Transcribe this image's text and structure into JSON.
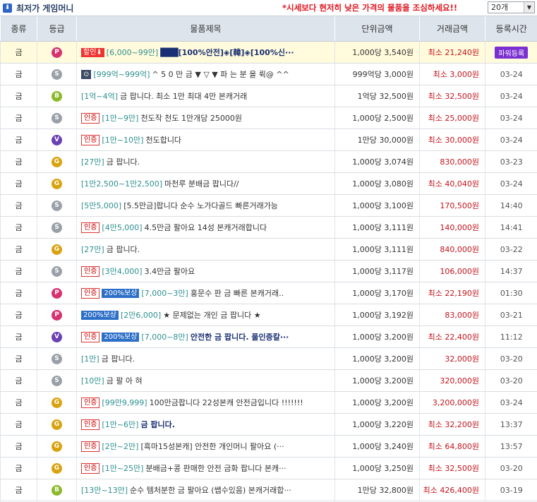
{
  "header": {
    "title": "최저가 게임머니",
    "notice": "*시세보다 현저히 낮은 가격의 물품을 조심하세요!!",
    "count_select": "20개"
  },
  "columns": [
    "종류",
    "등급",
    "물품제목",
    "단위금액",
    "거래금액",
    "등록시간"
  ],
  "rows": [
    {
      "kind": "금",
      "grade": "P",
      "badges": [
        {
          "t": "hot",
          "label": "할인⬇"
        }
      ],
      "range": "[6,000~99만]",
      "title": "███[100%안전]◈[韓]◈[100%신···",
      "title_bold": true,
      "unit": "1,000당 3,540원",
      "total": "최소 21,240원",
      "time": "",
      "power": "파워등록",
      "highlight": true
    },
    {
      "kind": "금",
      "grade": "S",
      "badges": [
        {
          "t": "camera",
          "label": "⊙"
        }
      ],
      "range": "[999억~999억]",
      "title": "^ 5 0 만 금 ▼ ▽ ▼ 파 는 분 을 뤽@ ^^",
      "unit": "999억당 3,000원",
      "total": "최소 3,000원",
      "time": "03-24"
    },
    {
      "kind": "금",
      "grade": "B",
      "badges": [],
      "range": "[1억~4억]",
      "title": "금 팝니다. 최소 1만 최대 4만 본캐거래",
      "unit": "1억당 32,500원",
      "total": "최소 32,500원",
      "time": "03-24"
    },
    {
      "kind": "금",
      "grade": "S",
      "badges": [
        {
          "t": "cert",
          "label": "인증"
        }
      ],
      "range": "[1만~9만]",
      "title": "천도작 천도 1만개당 25000원",
      "unit": "1,000당 2,500원",
      "total": "최소 25,000원",
      "time": "03-24"
    },
    {
      "kind": "금",
      "grade": "V",
      "badges": [
        {
          "t": "cert",
          "label": "인증"
        }
      ],
      "range": "[1만~10만]",
      "title": "천도합니다",
      "unit": "1만당 30,000원",
      "total": "최소 30,000원",
      "time": "03-24"
    },
    {
      "kind": "금",
      "grade": "G",
      "badges": [],
      "range": "[27만]",
      "title": "금 팝니다.",
      "unit": "1,000당 3,074원",
      "total": "830,000원",
      "time": "03-23"
    },
    {
      "kind": "금",
      "grade": "G",
      "badges": [],
      "range": "[1만2,500~1만2,500]",
      "title": "마천루 분배금 팝니다//",
      "unit": "1,000당 3,080원",
      "total": "최소 40,040원",
      "time": "03-24"
    },
    {
      "kind": "금",
      "grade": "S",
      "badges": [],
      "range": "[5만5,000]",
      "title": "[5.5만금]팝니다 순수 노가다골드 빠른거래가능",
      "unit": "1,000당 3,100원",
      "total": "170,500원",
      "time": "14:40"
    },
    {
      "kind": "금",
      "grade": "S",
      "badges": [
        {
          "t": "cert",
          "label": "인증"
        }
      ],
      "range": "[4만5,000]",
      "title": "4.5만금 팔아요 14성 본캐거래합니다",
      "unit": "1,000당 3,111원",
      "total": "140,000원",
      "time": "14:41"
    },
    {
      "kind": "금",
      "grade": "G",
      "badges": [],
      "range": "[27만]",
      "title": "금 팝니다.",
      "unit": "1,000당 3,111원",
      "total": "840,000원",
      "time": "03-22"
    },
    {
      "kind": "금",
      "grade": "S",
      "badges": [
        {
          "t": "cert",
          "label": "인증"
        }
      ],
      "range": "[3만4,000]",
      "title": "3.4만금 팔아요",
      "unit": "1,000당 3,117원",
      "total": "106,000원",
      "time": "14:37"
    },
    {
      "kind": "금",
      "grade": "P",
      "badges": [
        {
          "t": "cert",
          "label": "인증"
        },
        {
          "t": "comp",
          "label": "200%보상"
        }
      ],
      "range": "[7,000~3만]",
      "title": "홍문수 판 금 빠른 본캐거래..",
      "unit": "1,000당 3,170원",
      "total": "최소 22,190원",
      "time": "01:30"
    },
    {
      "kind": "금",
      "grade": "P",
      "badges": [
        {
          "t": "comp",
          "label": "200%보상"
        }
      ],
      "range": "[2만6,000]",
      "title": "★ 문제없는 개인 금 팝니다 ★",
      "unit": "1,000당 3,192원",
      "total": "83,000원",
      "time": "03-21"
    },
    {
      "kind": "금",
      "grade": "V",
      "badges": [
        {
          "t": "cert",
          "label": "인증"
        },
        {
          "t": "comp",
          "label": "200%보상"
        }
      ],
      "range": "[7,000~8만]",
      "title": "안전한 금 팝니다. 풀인증칼···",
      "title_bold": true,
      "unit": "1,000당 3,200원",
      "total": "최소 22,400원",
      "time": "11:12"
    },
    {
      "kind": "금",
      "grade": "S",
      "badges": [],
      "range": "[1만]",
      "title": "금 팝니다.",
      "unit": "1,000당 3,200원",
      "total": "32,000원",
      "time": "03-20"
    },
    {
      "kind": "금",
      "grade": "S",
      "badges": [],
      "range": "[10만]",
      "title": "금 팔 아 혀",
      "unit": "1,000당 3,200원",
      "total": "320,000원",
      "time": "03-20"
    },
    {
      "kind": "금",
      "grade": "G",
      "badges": [
        {
          "t": "cert",
          "label": "인증"
        }
      ],
      "range": "[99만9,999]",
      "title": "100만금팝니다 22성본캐 안전금입니다 !!!!!!!",
      "unit": "1,000당 3,200원",
      "total": "3,200,000원",
      "time": "03-24"
    },
    {
      "kind": "금",
      "grade": "G",
      "badges": [
        {
          "t": "cert",
          "label": "인증"
        }
      ],
      "range": "[1만~6만]",
      "title": "금 팝니다.",
      "title_bold": true,
      "unit": "1,000당 3,220원",
      "total": "최소 32,200원",
      "time": "13:37"
    },
    {
      "kind": "금",
      "grade": "G",
      "badges": [
        {
          "t": "cert",
          "label": "인증"
        }
      ],
      "range": "[2만~2만]",
      "title": "[흑마15성본캐] 안전한 개인머니 팔아요 (···",
      "unit": "1,000당 3,240원",
      "total": "최소 64,800원",
      "time": "13:57"
    },
    {
      "kind": "금",
      "grade": "G",
      "badges": [
        {
          "t": "cert",
          "label": "인증"
        }
      ],
      "range": "[1만~25만]",
      "title": "분배금+콩 판매한 안전 금화 팝니다 본캐···",
      "unit": "1,000당 3,250원",
      "total": "최소 32,500원",
      "time": "03-20"
    },
    {
      "kind": "금",
      "grade": "B",
      "badges": [],
      "range": "[13만~13만]",
      "title": "순수 템처분한 금 팔아요 (쌥수있음) 본캐거래합···",
      "unit": "1만당 32,800원",
      "total": "최소 426,400원",
      "time": "03-19"
    }
  ]
}
